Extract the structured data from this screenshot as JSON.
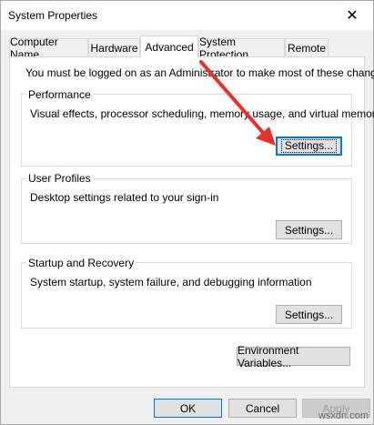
{
  "window": {
    "title": "System Properties",
    "close_glyph": "✕"
  },
  "tabs": [
    {
      "label": "Computer Name"
    },
    {
      "label": "Hardware"
    },
    {
      "label": "Advanced"
    },
    {
      "label": "System Protection"
    },
    {
      "label": "Remote"
    }
  ],
  "advanced": {
    "admin_note": "You must be logged on as an Administrator to make most of these changes.",
    "performance": {
      "title": "Performance",
      "description": "Visual effects, processor scheduling, memory usage, and virtual memory",
      "button": "Settings..."
    },
    "user_profiles": {
      "title": "User Profiles",
      "description": "Desktop settings related to your sign-in",
      "button": "Settings..."
    },
    "startup_recovery": {
      "title": "Startup and Recovery",
      "description": "System startup, system failure, and debugging information",
      "button": "Settings..."
    },
    "env_vars_button": "Environment Variables..."
  },
  "footer": {
    "ok": "OK",
    "cancel": "Cancel",
    "apply": "Apply"
  },
  "annotation": {
    "arrow_color": "#e8312a"
  },
  "watermark": "wsxdn.com"
}
